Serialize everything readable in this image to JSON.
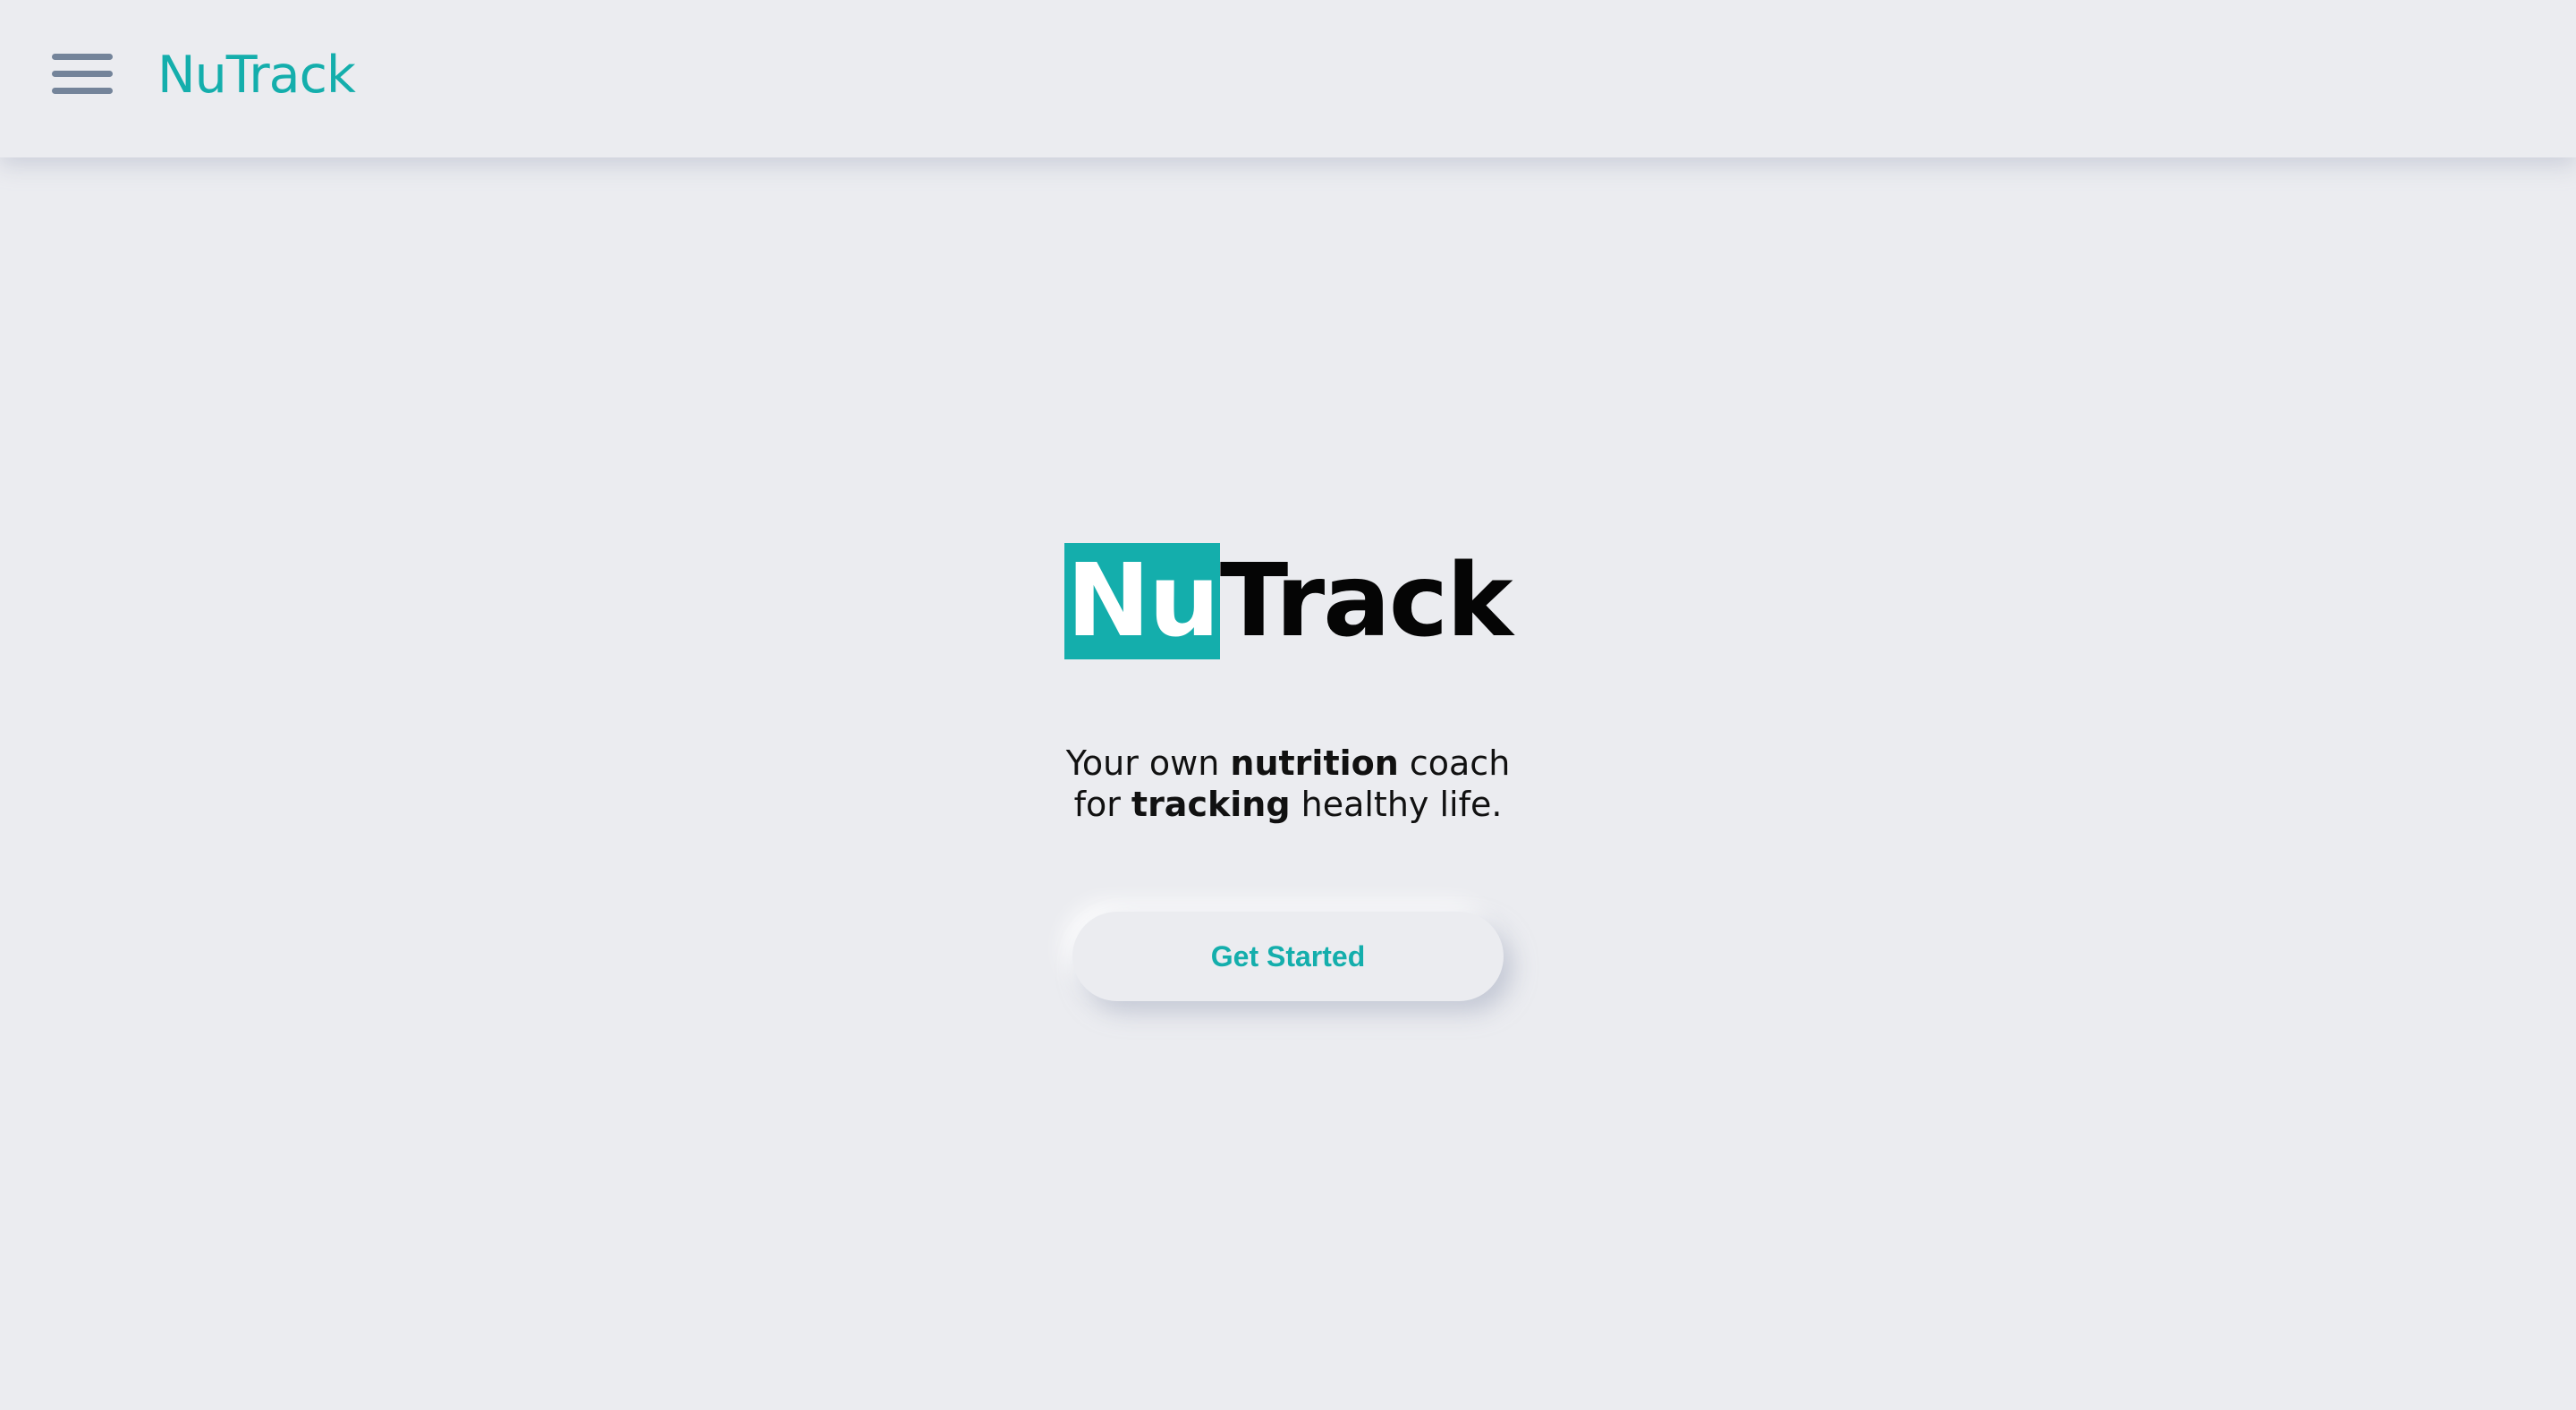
{
  "header": {
    "menu_icon": "hamburger-menu-icon",
    "brand": "NuTrack"
  },
  "hero": {
    "logo_highlight": "Nu",
    "logo_rest": "Track",
    "tagline": {
      "line1_pre": "Your own ",
      "line1_bold": "nutrition",
      "line1_post": " coach",
      "line2_pre": "for ",
      "line2_bold": "tracking",
      "line2_post": " healthy life."
    },
    "cta_label": "Get Started"
  },
  "colors": {
    "accent": "#14aeac",
    "background": "#ebecf0",
    "menu_icon": "#74849a"
  }
}
